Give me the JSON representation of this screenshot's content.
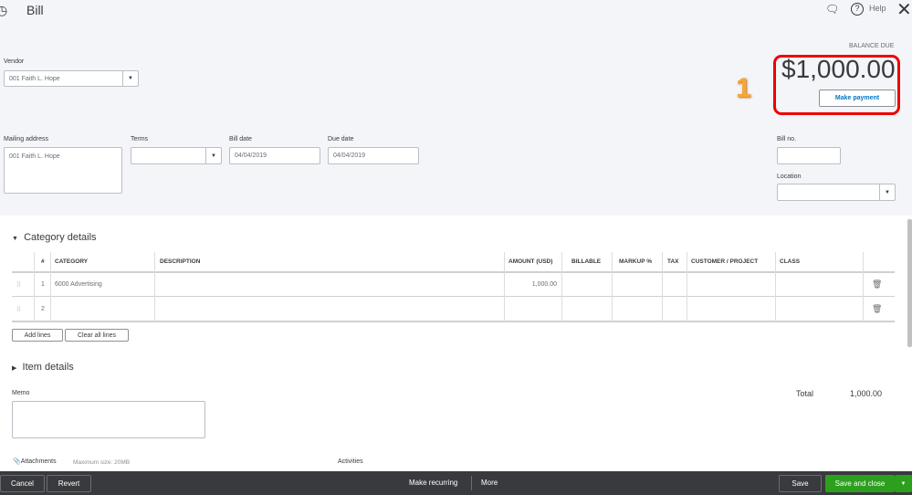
{
  "header": {
    "title": "Bill",
    "help_label": "Help"
  },
  "balance": {
    "label": "BALANCE DUE",
    "amount": "$1,000.00",
    "make_payment": "Make payment",
    "annotation": "1"
  },
  "vendor": {
    "label": "Vendor",
    "value": "001 Faith L. Hope"
  },
  "mailing": {
    "label": "Mailing address",
    "value": "001 Faith L. Hope"
  },
  "terms": {
    "label": "Terms",
    "value": ""
  },
  "bill_date": {
    "label": "Bill date",
    "value": "04/04/2019"
  },
  "due_date": {
    "label": "Due date",
    "value": "04/04/2019"
  },
  "bill_no": {
    "label": "Bill no.",
    "value": ""
  },
  "location": {
    "label": "Location",
    "value": ""
  },
  "category": {
    "title": "Category details",
    "columns": [
      "#",
      "CATEGORY",
      "DESCRIPTION",
      "AMOUNT (USD)",
      "BILLABLE",
      "MARKUP %",
      "TAX",
      "CUSTOMER / PROJECT",
      "CLASS"
    ],
    "rows": [
      {
        "num": "1",
        "category": "6000 Advertising",
        "amount": "1,000.00"
      },
      {
        "num": "2",
        "category": "",
        "amount": ""
      }
    ],
    "add_lines": "Add lines",
    "clear_lines": "Clear all lines"
  },
  "item": {
    "title": "Item details"
  },
  "memo": {
    "label": "Memo"
  },
  "total": {
    "label": "Total",
    "value": "1,000.00"
  },
  "attachments": {
    "label": "Attachments",
    "max": "Maximum size: 20MB"
  },
  "activities": {
    "label": "Activities"
  },
  "footer": {
    "cancel": "Cancel",
    "revert": "Revert",
    "recurring": "Make recurring",
    "more": "More",
    "save": "Save",
    "save_close": "Save and close"
  }
}
